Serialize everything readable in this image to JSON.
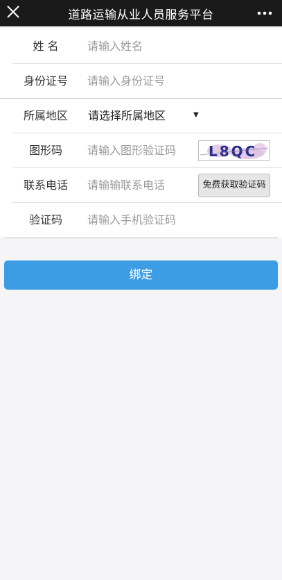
{
  "header": {
    "title": "道路运输从业人员服务平台",
    "close_icon": "close-icon",
    "more_icon": "more-icon"
  },
  "form": {
    "name": {
      "label": "姓 名",
      "placeholder": "请输入姓名"
    },
    "id_number": {
      "label": "身份证号",
      "placeholder": "请输入身份证号"
    },
    "region": {
      "label": "所属地区",
      "selected": "请选择所属地区"
    },
    "captcha": {
      "label": "图形码",
      "placeholder": "请输入图形验证码",
      "image_text": "L8QC"
    },
    "phone": {
      "label": "联系电话",
      "placeholder": "请输输联系电话",
      "sms_button": "免费获取验证码"
    },
    "sms_code": {
      "label": "验证码",
      "placeholder": "请输入手机验证码"
    }
  },
  "actions": {
    "bind_label": "绑定"
  },
  "colors": {
    "primary": "#3c9ce4",
    "header_bg": "#1a1a1a",
    "page_bg": "#f5f5f7"
  }
}
